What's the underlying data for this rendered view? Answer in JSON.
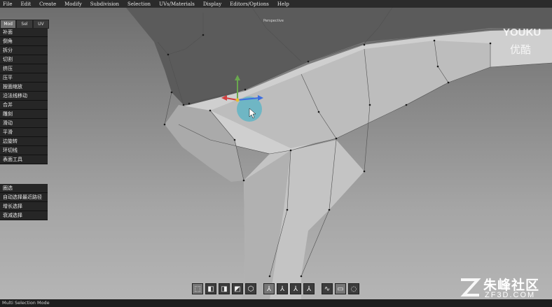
{
  "menu": [
    "File",
    "Edit",
    "Create",
    "Modify",
    "Subdivision",
    "Selection",
    "UVs/Materials",
    "Display",
    "Editors/Options",
    "Help"
  ],
  "viewport": {
    "label": "Perspective"
  },
  "panel": {
    "tabs": [
      "Mod",
      "Sel",
      "UV"
    ],
    "tools": [
      "补面",
      "倒角",
      "拆分",
      "切割",
      "挤压",
      "压平",
      "按面缩放",
      "沿法线移动",
      "合并",
      "雕刻",
      "滑动",
      "平滑",
      "边旋转",
      "环切线",
      "表面工具"
    ],
    "selection_tools": [
      "圈选",
      "自动选择最近路径",
      "增长选择",
      "衰减选择"
    ]
  },
  "toolbar": {
    "icons": [
      "multi-select-icon",
      "cube-front-icon",
      "cube-side-icon",
      "cube-top-icon",
      "cube-outline-icon",
      "axis-local-icon",
      "axis-world-icon",
      "axis-object-icon",
      "axis-screen-icon",
      "lasso-icon",
      "box-select-icon",
      "paint-select-icon"
    ]
  },
  "status": {
    "text": "Multi Selection Mode"
  },
  "watermark": {
    "brand": "YOUKU",
    "brand_cn": "优酷",
    "site": "朱峰社区",
    "site_url": "ZF3D.COM"
  },
  "colors": {
    "menubar": "#2b2b2b",
    "panel_button": "#262626",
    "gizmo_sphere": "#4fb4c8",
    "status": "#1e1e1e"
  }
}
